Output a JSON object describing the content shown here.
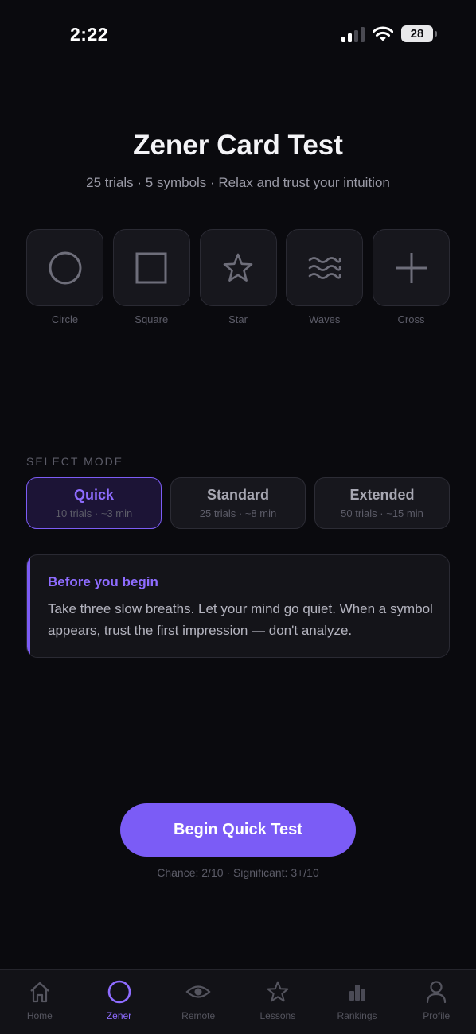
{
  "status_bar": {
    "time": "2:22",
    "battery": "28"
  },
  "header": {
    "title": "Zener Card Test",
    "subtitle": "25 trials · 5 symbols · Relax and trust your intuition"
  },
  "symbols": [
    {
      "label": "Circle",
      "icon": "circle-icon"
    },
    {
      "label": "Square",
      "icon": "square-icon"
    },
    {
      "label": "Star",
      "icon": "star-icon"
    },
    {
      "label": "Waves",
      "icon": "waves-icon"
    },
    {
      "label": "Cross",
      "icon": "cross-icon"
    }
  ],
  "mode": {
    "heading": "SELECT MODE",
    "options": [
      {
        "name": "Quick",
        "detail": "10 trials · ~3 min",
        "selected": true
      },
      {
        "name": "Standard",
        "detail": "25 trials · ~8 min",
        "selected": false
      },
      {
        "name": "Extended",
        "detail": "50 trials · ~15 min",
        "selected": false
      }
    ]
  },
  "info": {
    "title": "Before you begin",
    "body": "Take three slow breaths. Let your mind go quiet. When a symbol appears, trust the first impression — don't analyze."
  },
  "cta": {
    "label": "Begin Quick Test",
    "odds": "Chance: 2/10 · Significant: 3+/10"
  },
  "tabs": [
    {
      "label": "Home",
      "icon": "home-icon",
      "active": false
    },
    {
      "label": "Zener",
      "icon": "circle-icon",
      "active": true
    },
    {
      "label": "Remote",
      "icon": "eye-icon",
      "active": false
    },
    {
      "label": "Lessons",
      "icon": "star-icon",
      "active": false
    },
    {
      "label": "Rankings",
      "icon": "bar-chart-icon",
      "active": false
    },
    {
      "label": "Profile",
      "icon": "user-icon",
      "active": false
    }
  ],
  "colors": {
    "background": "#0a0a0e",
    "accent": "#7b5cf6",
    "accent_text": "#8e6cff",
    "card": "#17171d"
  }
}
